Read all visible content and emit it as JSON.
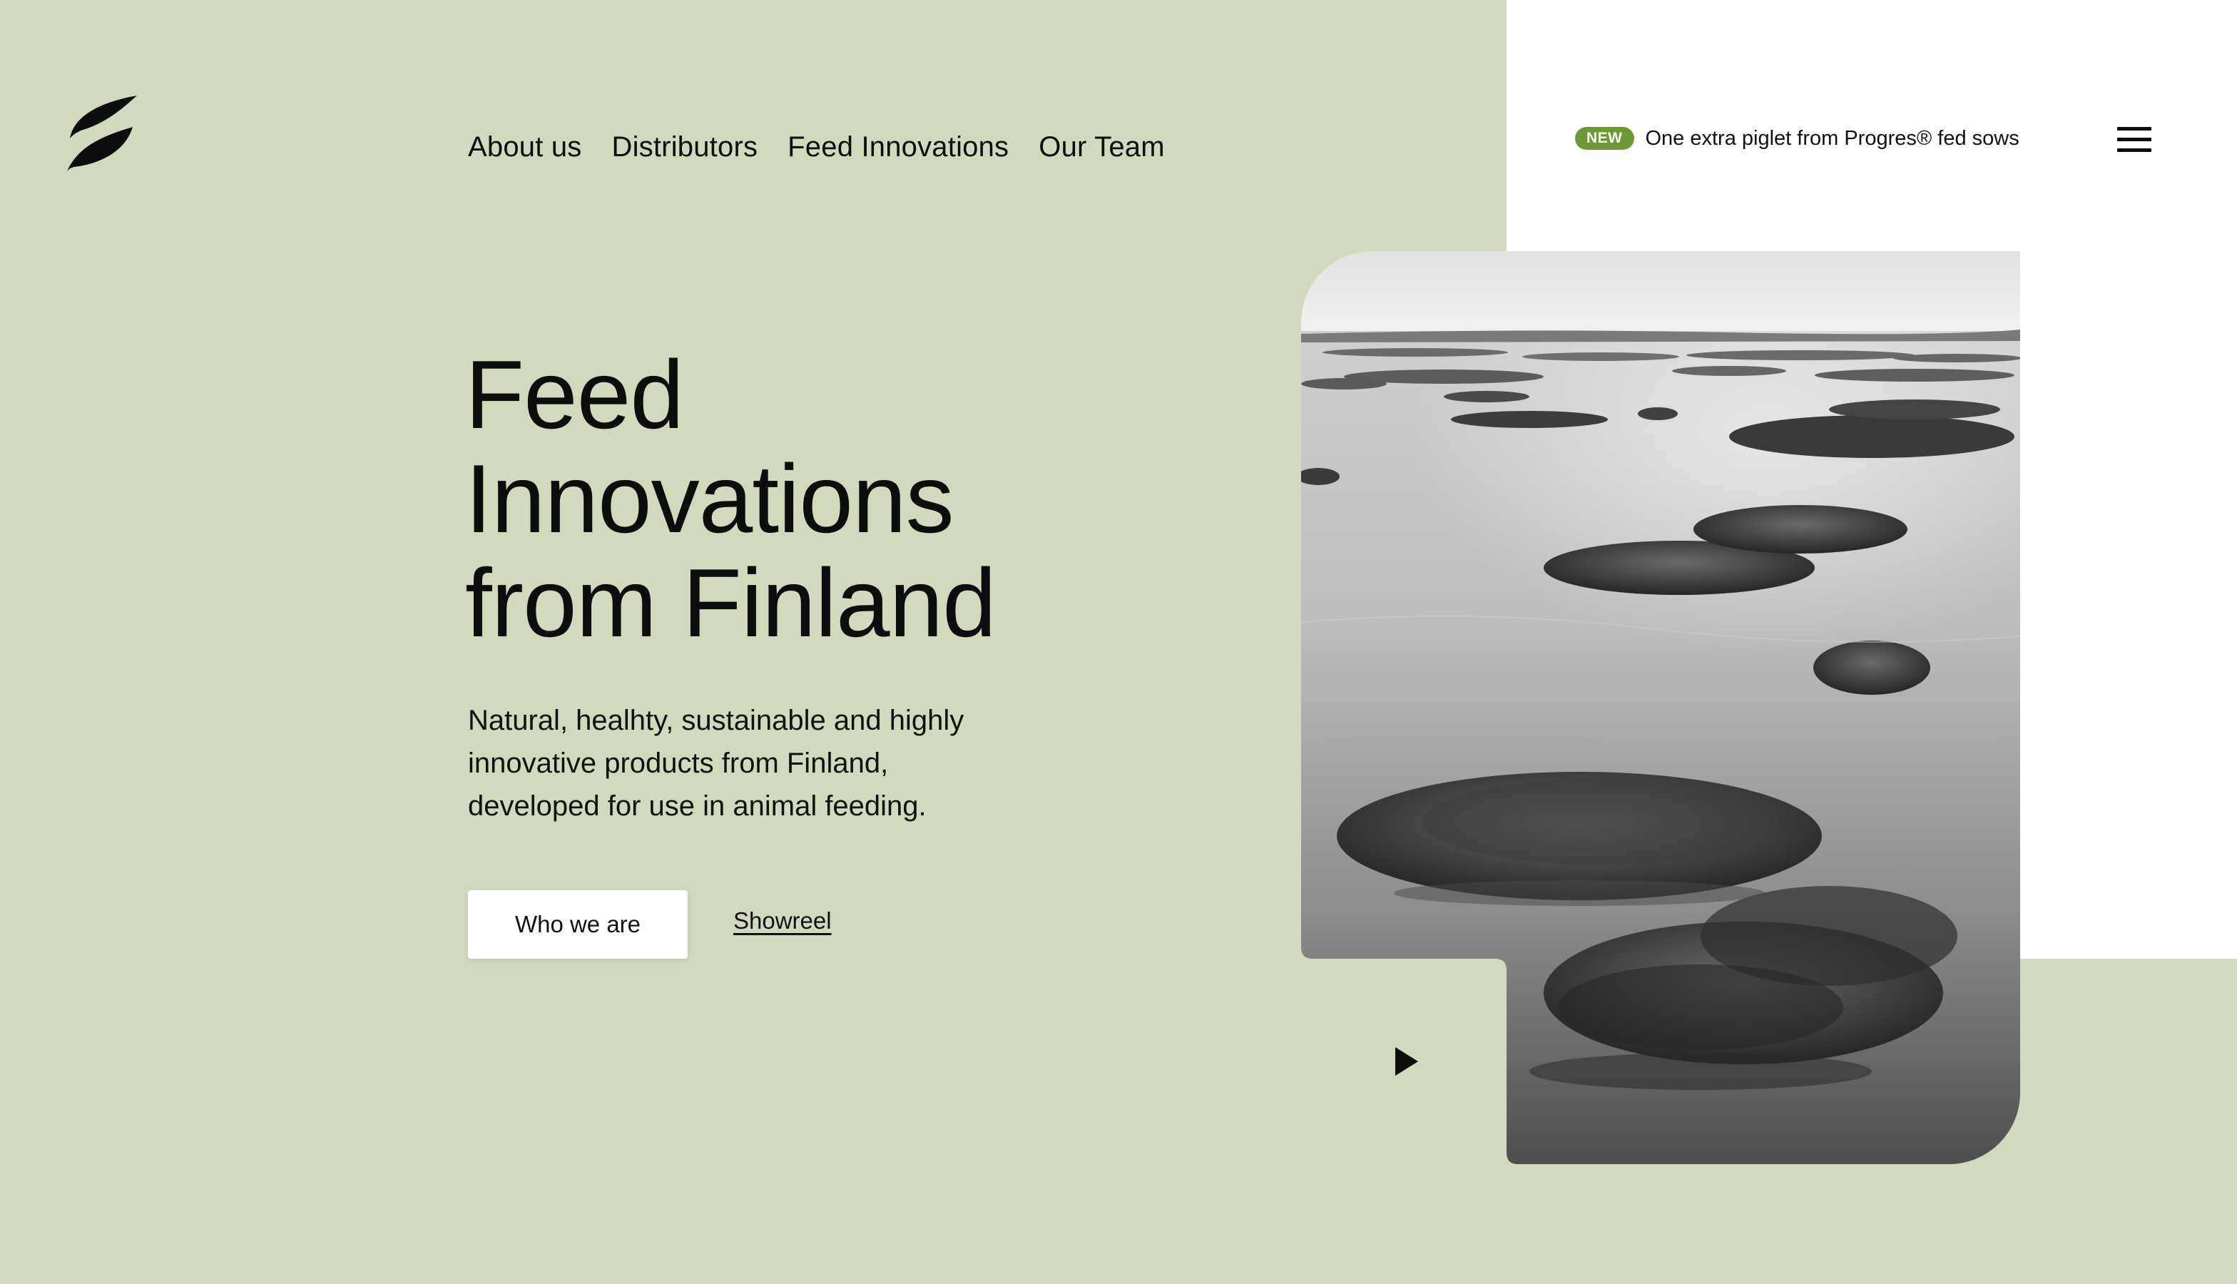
{
  "nav": {
    "logo_alt": "leaf-logo",
    "items": [
      {
        "label": "About us"
      },
      {
        "label": "Distributors"
      },
      {
        "label": "Feed Innovations"
      },
      {
        "label": "Our Team"
      }
    ]
  },
  "announcement": {
    "badge": "NEW",
    "text": "One extra piglet from Progres® fed sows"
  },
  "hero": {
    "headline": [
      "Feed",
      "Innovations",
      "from Finland"
    ],
    "description": [
      "Natural, healhty, sustainable and highly",
      "innovative products from Finland,",
      "developed for use in animal feeding."
    ],
    "primary_button": "Who we are",
    "secondary_link": "Showreel"
  },
  "colors": {
    "background": "#d2dabe",
    "panel": "#ffffff",
    "badge": "#6b9a34",
    "text": "#0d0d0d"
  },
  "icons": {
    "logo": "leaf-icon",
    "menu": "hamburger-menu-icon",
    "play": "play-icon"
  }
}
